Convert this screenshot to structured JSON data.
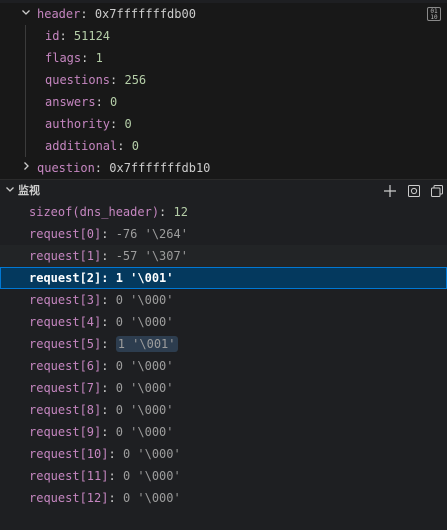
{
  "variables": {
    "header": {
      "name": "header",
      "value": "0x7fffffffdb00",
      "fields": [
        {
          "key": "id",
          "value": "51124"
        },
        {
          "key": "flags",
          "value": "1"
        },
        {
          "key": "questions",
          "value": "256"
        },
        {
          "key": "answers",
          "value": "0"
        },
        {
          "key": "authority",
          "value": "0"
        },
        {
          "key": "additional",
          "value": "0"
        }
      ]
    },
    "question": {
      "name": "question",
      "value": "0x7fffffffdb10"
    },
    "memory_icon_text": "01\n10"
  },
  "watch": {
    "title": "监视",
    "items": [
      {
        "expr": "sizeof(dns_header)",
        "value": "12"
      },
      {
        "expr": "request[0]",
        "value": "-76 '\\264'"
      },
      {
        "expr": "request[1]",
        "value": "-57 '\\307'"
      },
      {
        "expr": "request[2]",
        "value": "1 '\\001'"
      },
      {
        "expr": "request[3]",
        "value": "0 '\\000'"
      },
      {
        "expr": "request[4]",
        "value": "0 '\\000'"
      },
      {
        "expr": "request[5]",
        "value": "1 '\\001'"
      },
      {
        "expr": "request[6]",
        "value": "0 '\\000'"
      },
      {
        "expr": "request[7]",
        "value": "0 '\\000'"
      },
      {
        "expr": "request[8]",
        "value": "0 '\\000'"
      },
      {
        "expr": "request[9]",
        "value": "0 '\\000'"
      },
      {
        "expr": "request[10]",
        "value": "0 '\\000'"
      },
      {
        "expr": "request[11]",
        "value": "0 '\\000'"
      },
      {
        "expr": "request[12]",
        "value": "0 '\\000'"
      }
    ]
  }
}
